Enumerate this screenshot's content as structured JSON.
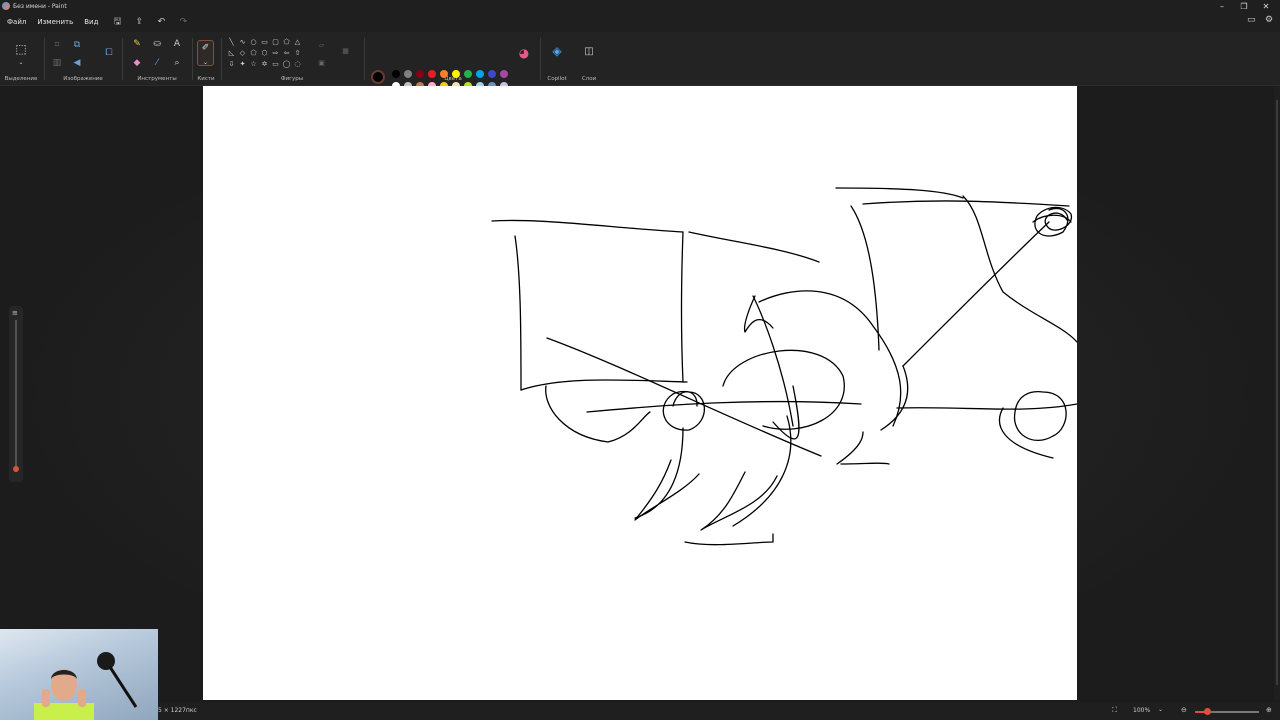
{
  "window": {
    "title": "Без имени - Paint",
    "controls": {
      "minimize": "–",
      "restore": "❐",
      "close": "✕"
    }
  },
  "menu": {
    "items": [
      "Файл",
      "Изменить",
      "Вид"
    ],
    "quick_actions": [
      {
        "name": "save-icon",
        "glyph": "🖫"
      },
      {
        "name": "share-icon",
        "glyph": "⇪"
      },
      {
        "name": "undo-icon",
        "glyph": "↶"
      },
      {
        "name": "redo-icon",
        "glyph": "↷"
      }
    ],
    "right_icons": [
      {
        "name": "notifications-icon",
        "glyph": "▭"
      },
      {
        "name": "settings-icon",
        "glyph": "⚙"
      }
    ]
  },
  "ribbon": {
    "groups": {
      "selection": "Выделение",
      "image": "Изображение",
      "tools": "Инструменты",
      "brushes": "Кисти",
      "shapes": "Фигуры",
      "colors": "Цвета",
      "copilot": "Copilot",
      "layers": "Слои"
    },
    "palette": {
      "primary": "#000000",
      "secondary": "#ffffff",
      "row1": [
        "#000000",
        "#7f7f7f",
        "#880015",
        "#ed1c24",
        "#ff7f27",
        "#fff200",
        "#22b14c",
        "#00a2e8",
        "#3f48cc",
        "#a349a4"
      ],
      "row2": [
        "#ffffff",
        "#c3c3c3",
        "#b97a57",
        "#ffaec9",
        "#ffc90e",
        "#efe4b0",
        "#b5e61d",
        "#99d9ea",
        "#7092be",
        "#c8bfe7"
      ]
    },
    "accent": "#d9533c"
  },
  "status": {
    "dimensions": "5 × 1227пкс",
    "zoom": "100%",
    "zoom_level": 0.18
  }
}
